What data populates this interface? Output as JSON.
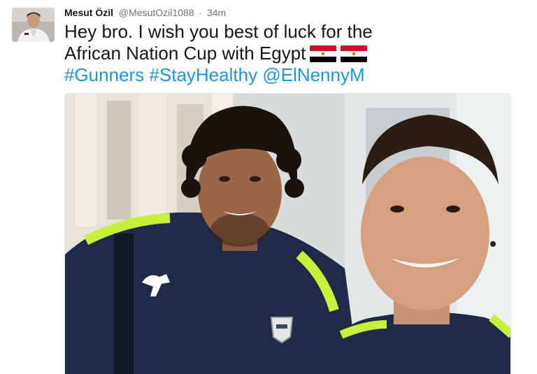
{
  "tweet": {
    "author": {
      "display_name": "Mesut Özil",
      "handle": "@MesutOzil1088",
      "avatar_icon": "user-avatar"
    },
    "separator": "·",
    "timestamp": "34m",
    "text": {
      "line1": "Hey bro. I wish you best of luck for the",
      "line2": "African Nation Cup with Egypt",
      "flags": [
        "egypt-flag",
        "egypt-flag"
      ],
      "tags": [
        "#Gunners",
        "#StayHealthy",
        "@ElNennyM"
      ]
    },
    "media": {
      "kind": "photo",
      "description_icon": "selfie-photo"
    },
    "colors": {
      "link": "#1b95e0",
      "muted": "#657786",
      "text": "#14171a"
    }
  }
}
